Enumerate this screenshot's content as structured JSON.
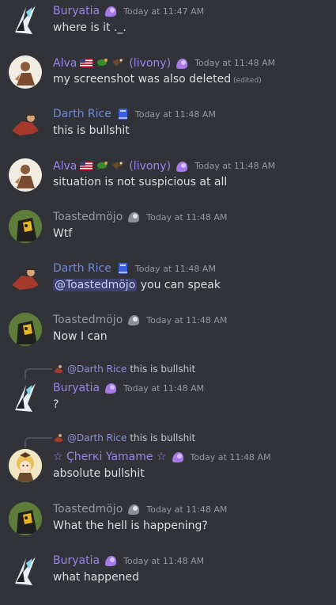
{
  "colors": {
    "background": "#313338",
    "buryatia": "#9b84ec",
    "alva": "#9b84ec",
    "darth_rice": "#7289da",
    "toasted": "#949ba4",
    "cherki": "#9b84ec"
  },
  "messages": [
    {
      "author": "Buryatia",
      "timestamp": "Today at 11:47 AM",
      "content": "where is it ._."
    },
    {
      "author": "Alva",
      "author_suffix": "(livony)",
      "timestamp": "Today at 11:48 AM",
      "content": "my screenshot was also deleted",
      "edited": "(edited)"
    },
    {
      "author": "Darth Rice",
      "timestamp": "Today at 11:48 AM",
      "content": "this is bullshit"
    },
    {
      "author": "Alva",
      "author_suffix": "(livony)",
      "timestamp": "Today at 11:48 AM",
      "content": "situation is not suspicious at all"
    },
    {
      "author": "Toastedmöjo",
      "timestamp": "Today at 11:48 AM",
      "content": "Wtf"
    },
    {
      "author": "Darth Rice",
      "timestamp": "Today at 11:48 AM",
      "mention": "@Toastedmöjo",
      "content": " you can speak"
    },
    {
      "author": "Toastedmöjo",
      "timestamp": "Today at 11:48 AM",
      "content": "Now I can"
    },
    {
      "reply_author": "@Darth Rice",
      "reply_text": "this is bullshit",
      "author": "Buryatia",
      "timestamp": "Today at 11:48 AM",
      "content": "?"
    },
    {
      "reply_author": "@Darth Rice",
      "reply_text": "this is bullshit",
      "author": "☆ Çherкi Yamame ☆",
      "timestamp": "Today at 11:48 AM",
      "content": "absolute bullshit"
    },
    {
      "author": "Toastedmöjo",
      "timestamp": "Today at 11:48 AM",
      "content": "What the hell is happening?"
    },
    {
      "author": "Buryatia",
      "timestamp": "Today at 11:48 AM",
      "content": "what happened"
    }
  ]
}
